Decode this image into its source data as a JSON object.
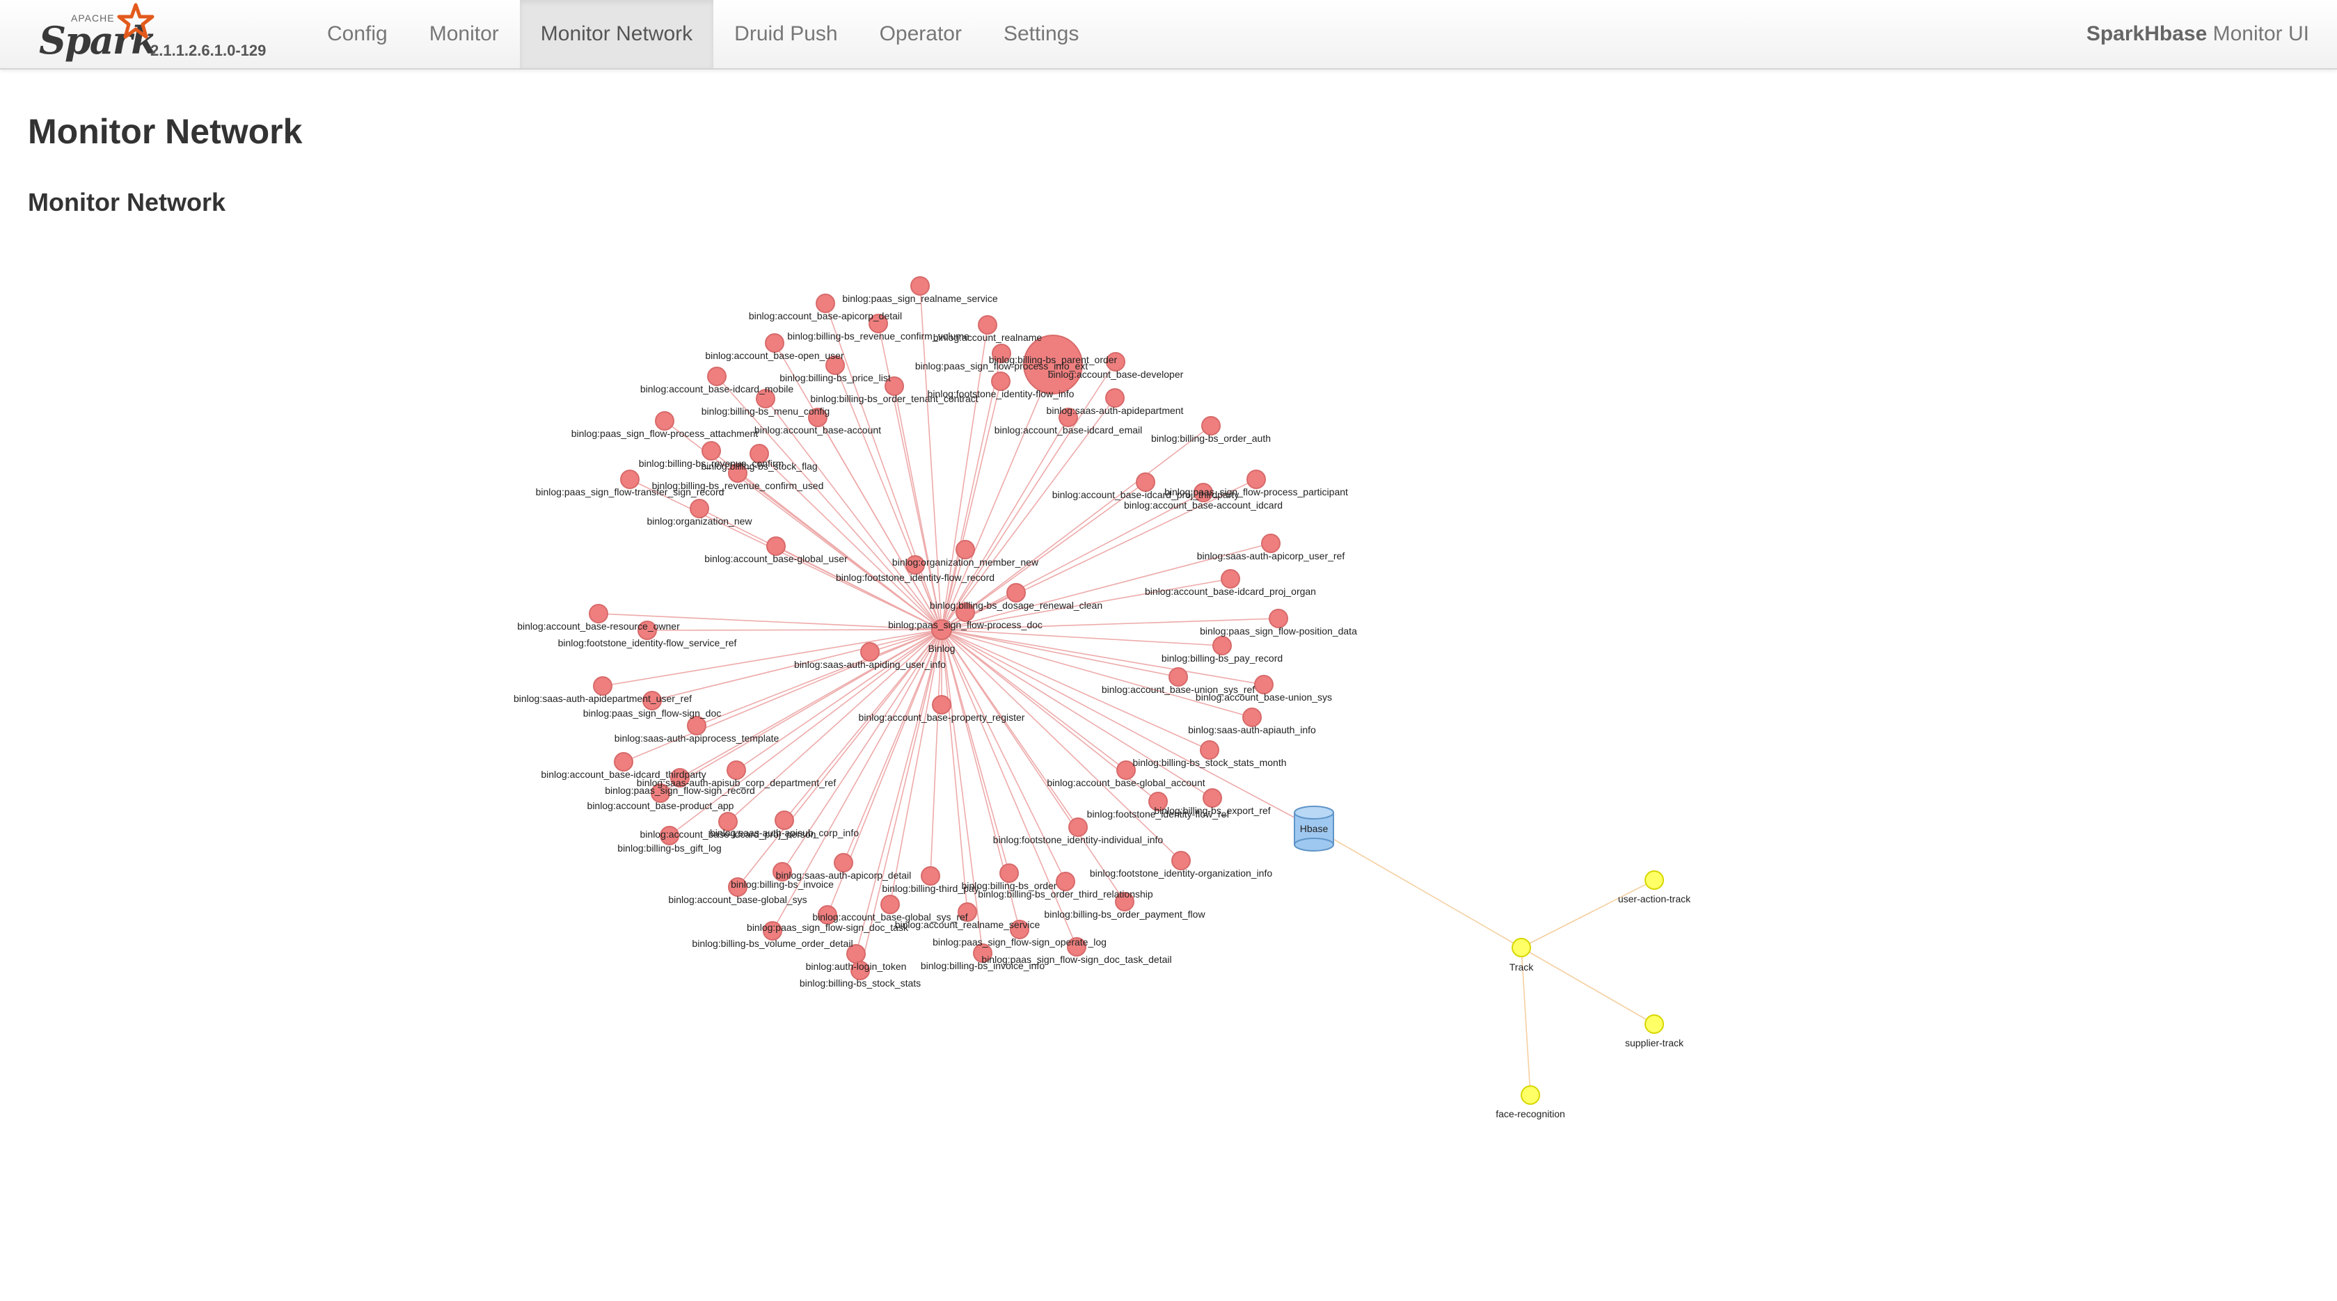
{
  "navbar": {
    "brand_small": "APACHE",
    "brand_name": "Spark",
    "version": "2.1.1.2.6.1.0-129",
    "tabs": [
      {
        "label": "Config",
        "active": false
      },
      {
        "label": "Monitor",
        "active": false
      },
      {
        "label": "Monitor Network",
        "active": true
      },
      {
        "label": "Druid Push",
        "active": false
      },
      {
        "label": "Operator",
        "active": false
      },
      {
        "label": "Settings",
        "active": false
      }
    ],
    "app_title_bold": "SparkHbase",
    "app_title_rest": " Monitor UI"
  },
  "page": {
    "title": "Monitor Network",
    "section_title": "Monitor Network"
  },
  "colors": {
    "red_node": "#ef7f7f",
    "red_node_stroke": "#d86a6a",
    "yellow_node": "#ffff66",
    "yellow_node_stroke": "#d6d600",
    "hbase": "#9fc8f0",
    "red_edge": "#eeaaaa",
    "yellow_edge": "#f5cfa0"
  },
  "network": {
    "hub": "Binlog",
    "hbase": "Hbase",
    "track": "Track",
    "track_children": [
      "user-action-track",
      "supplier-track",
      "face-recognition"
    ],
    "big_node": "binlog:billing-bs_parent_order",
    "binlog_nodes": [
      "binlog:account_base-apicorp_detail",
      "binlog:paas_sign_realname_service",
      "binlog:billing-bs_revenue_confirm_volume",
      "binlog:account_realname",
      "binlog:account_base-open_user",
      "binlog:paas_sign_flow-process_info_ext",
      "binlog:billing-bs_price_list",
      "binlog:footstone_identity-flow_info",
      "binlog:account_base-developer",
      "binlog:account_base-idcard_mobile",
      "binlog:billing-bs_menu_config",
      "binlog:billing-bs_order_tenant_contract",
      "binlog:saas-auth-apidepartment",
      "binlog:paas_sign_flow-process_attachment",
      "binlog:account_base-account",
      "binlog:account_base-idcard_email",
      "binlog:billing-bs_order_auth",
      "binlog:billing-bs_revenue_confirm",
      "binlog:billing-bs_stock_flag",
      "binlog:account_base-idcard_proj_thirdparty",
      "binlog:billing-bs_revenue_confirm_used",
      "binlog:paas_sign_flow-transfer_sign_record",
      "binlog:paas_sign_flow-process_participant",
      "binlog:account_base-account_idcard",
      "binlog:organization_new",
      "binlog:account_base-global_user",
      "binlog:saas-auth-apicorp_user_ref",
      "binlog:organization_member_new",
      "binlog:footstone_identity-flow_record",
      "binlog:account_base-idcard_proj_organ",
      "binlog:billing-bs_dosage_renewal_clean",
      "binlog:paas_sign_flow-process_doc",
      "binlog:paas_sign_flow-position_data",
      "binlog:account_base-resource_owner",
      "binlog:footstone_identity-flow_service_ref",
      "binlog:billing-bs_pay_record",
      "binlog:saas-auth-apiding_user_info",
      "binlog:saas-auth-apidepartment_user_ref",
      "binlog:account_base-union_sys_ref",
      "binlog:account_base-union_sys",
      "binlog:paas_sign_flow-sign_doc",
      "binlog:saas-auth-apiprocess_template",
      "binlog:account_base-property_register",
      "binlog:saas-auth-apiauth_info",
      "binlog:account_base-idcard_thirdparty",
      "binlog:billing-bs_stock_stats_month",
      "binlog:paas_sign_flow-sign_record",
      "binlog:saas-auth-apisub_corp_department_ref",
      "binlog:account_base-global_account",
      "binlog:account_base-product_app",
      "binlog:footstone_identity-flow_ref",
      "binlog:billing-bs_export_ref",
      "binlog:account_base-idcard_proj_person",
      "binlog:saas-auth-apisub_corp_info",
      "binlog:billing-bs_gift_log",
      "binlog:footstone_identity-individual_info",
      "binlog:saas-auth-apicorp_detail",
      "binlog:footstone_identity-organization_info",
      "binlog:billing-bs_invoice",
      "binlog:billing-bs_order",
      "binlog:billing-third_pay",
      "binlog:account_base-global_sys",
      "binlog:billing-bs_order_third_relationship",
      "binlog:account_base-global_sys_ref",
      "binlog:billing-bs_order_payment_flow",
      "binlog:billing-bs_volume_order_detail",
      "binlog:paas_sign_flow-sign_doc_task",
      "binlog:account_realname_service",
      "binlog:paas_sign_flow-sign_operate_log",
      "binlog:auth-login_token",
      "binlog:paas_sign_flow-sign_doc_task_detail",
      "binlog:billing-bs_stock_stats",
      "binlog:billing-bs_invoice_info"
    ]
  }
}
